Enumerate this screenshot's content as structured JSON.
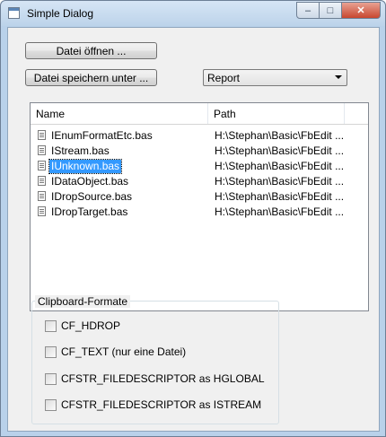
{
  "window": {
    "title": "Simple Dialog",
    "caption_buttons": {
      "minimize": "–",
      "maximize": "□",
      "close": "✕"
    }
  },
  "buttons": {
    "open": "Datei öffnen ...",
    "save_as": "Datei speichern unter ..."
  },
  "format_select": {
    "value": "Report"
  },
  "list": {
    "columns": [
      "Name",
      "Path"
    ],
    "rows": [
      {
        "name": "IEnumFormatEtc.bas",
        "path": "H:\\Stephan\\Basic\\FbEdit ...",
        "selected": false
      },
      {
        "name": "IStream.bas",
        "path": "H:\\Stephan\\Basic\\FbEdit ...",
        "selected": false
      },
      {
        "name": "IUnknown.bas",
        "path": "H:\\Stephan\\Basic\\FbEdit ...",
        "selected": true
      },
      {
        "name": "IDataObject.bas",
        "path": "H:\\Stephan\\Basic\\FbEdit ...",
        "selected": false
      },
      {
        "name": "IDropSource.bas",
        "path": "H:\\Stephan\\Basic\\FbEdit ...",
        "selected": false
      },
      {
        "name": "IDropTarget.bas",
        "path": "H:\\Stephan\\Basic\\FbEdit ...",
        "selected": false
      }
    ]
  },
  "clipboard": {
    "label": "Clipboard-Formate",
    "options": [
      {
        "label": "CF_HDROP",
        "checked": false
      },
      {
        "label": "CF_TEXT (nur eine Datei)",
        "checked": false
      },
      {
        "label": "CFSTR_FILEDESCRIPTOR as HGLOBAL",
        "checked": false
      },
      {
        "label": "CFSTR_FILEDESCRIPTOR as ISTREAM",
        "checked": false
      }
    ]
  }
}
